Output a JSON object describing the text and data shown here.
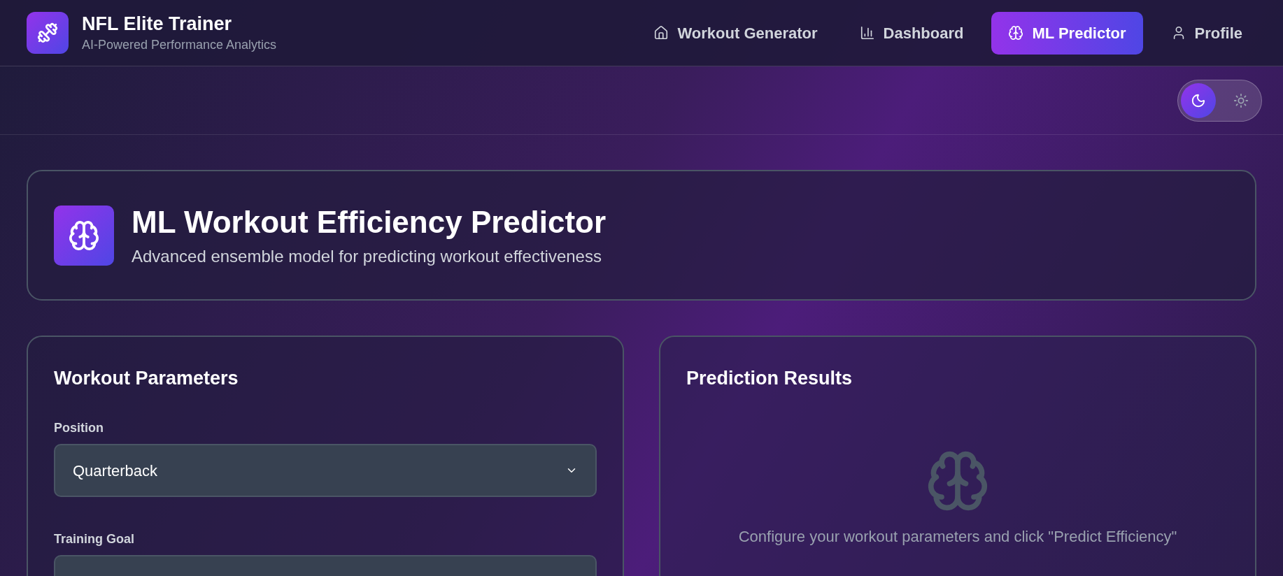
{
  "app": {
    "title": "NFL Elite Trainer",
    "subtitle": "AI-Powered Performance Analytics"
  },
  "nav": [
    {
      "label": "Workout Generator",
      "selected": false
    },
    {
      "label": "Dashboard",
      "selected": false
    },
    {
      "label": "ML Predictor",
      "selected": true
    },
    {
      "label": "Profile",
      "selected": false
    }
  ],
  "theme": {
    "dark": true
  },
  "hero": {
    "title": "ML Workout Efficiency Predictor",
    "subtitle": "Advanced ensemble model for predicting workout effectiveness"
  },
  "parameters": {
    "title": "Workout Parameters",
    "fields": [
      {
        "label": "Position",
        "value": "Quarterback"
      },
      {
        "label": "Training Goal"
      }
    ]
  },
  "results": {
    "title": "Prediction Results",
    "message": "Configure your workout parameters and click \"Predict Efficiency\""
  }
}
